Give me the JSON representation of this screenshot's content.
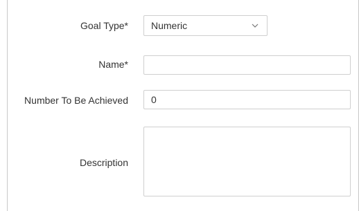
{
  "form": {
    "goal_type": {
      "label": "Goal Type*",
      "selected": "Numeric"
    },
    "name": {
      "label": "Name*",
      "value": ""
    },
    "number_to_be_achieved": {
      "label": "Number To Be Achieved",
      "value": "0"
    },
    "description": {
      "label": "Description",
      "value": ""
    }
  }
}
